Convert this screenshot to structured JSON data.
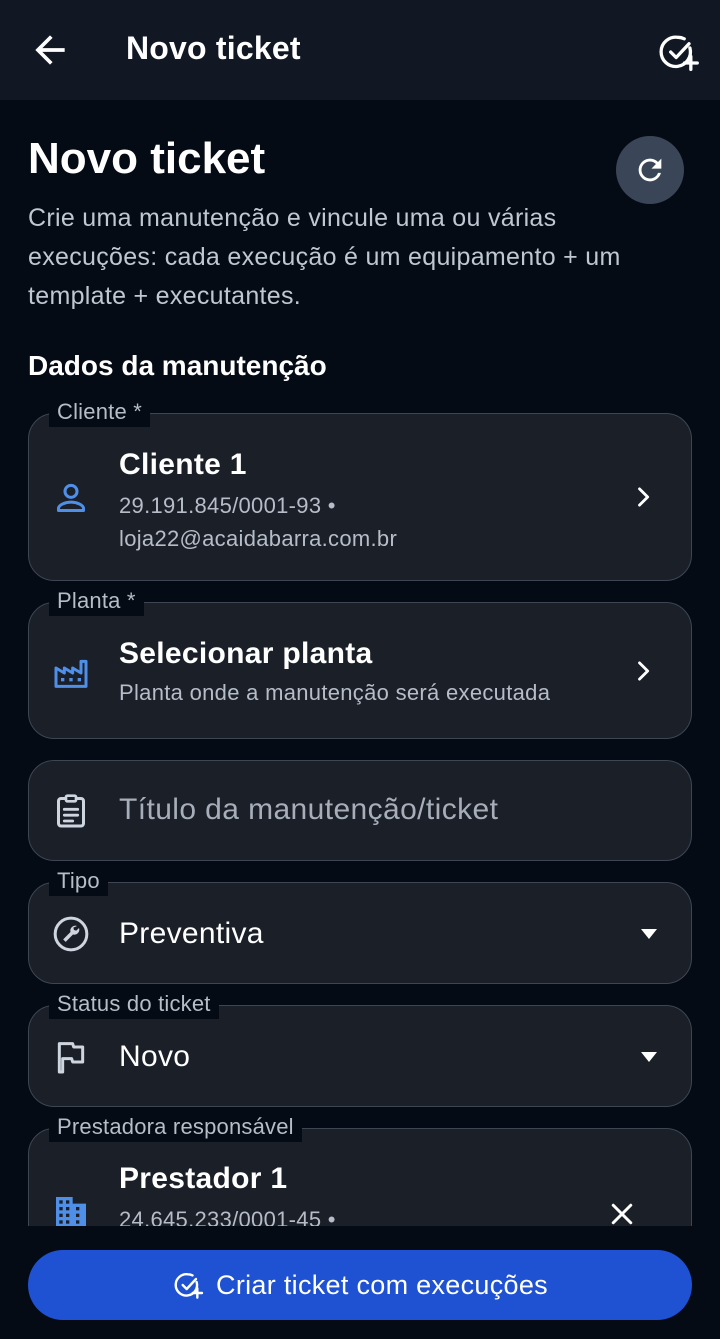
{
  "appbar": {
    "title": "Novo ticket",
    "back_icon": "arrow-left-icon",
    "action_icon": "check-circle-plus-icon"
  },
  "header": {
    "title": "Novo ticket",
    "description": "Crie uma manutenção e vincule uma ou várias execuções: cada execução é um equipamento + um template + executantes.",
    "refresh_icon": "refresh-icon"
  },
  "section": {
    "title": "Dados da manutenção"
  },
  "cliente": {
    "label": "Cliente *",
    "name": "Cliente 1",
    "line1": "29.191.845/0001-93 •",
    "line2": "loja22@acaidabarra.com.br",
    "icon": "person-icon"
  },
  "planta": {
    "label": "Planta *",
    "name": "Selecionar planta",
    "hint": "Planta onde a manutenção será executada",
    "icon": "factory-icon"
  },
  "titulo": {
    "placeholder": "Título da manutenção/ticket",
    "icon": "clipboard-icon"
  },
  "tipo": {
    "label": "Tipo",
    "value": "Preventiva",
    "icon": "wrench-icon"
  },
  "status": {
    "label": "Status do ticket",
    "value": "Novo",
    "icon": "flag-icon"
  },
  "prestadora": {
    "label": "Prestadora responsável",
    "name": "Prestador 1",
    "line1": "24.645.233/0001-45 •",
    "icon": "building-icon",
    "clear_icon": "close-icon"
  },
  "cta": {
    "label": "Criar ticket com execuções",
    "icon": "check-circle-plus-icon"
  },
  "colors": {
    "accent": "#1f51d3",
    "icon_blue": "#4f8fe8",
    "background": "#050b14",
    "field": "#1a1f28"
  }
}
